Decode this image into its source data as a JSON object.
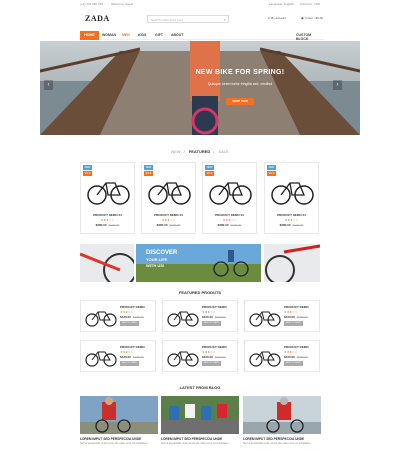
{
  "topbar": {
    "phone": "(+1) 234 566 789",
    "store": "Welcome, Guest",
    "language": "Language: English",
    "currency": "Currency: USD"
  },
  "header": {
    "logo": "ZADA",
    "search_placeholder": "Search entire store here",
    "account": "My account",
    "cart": "0 item - $0.00"
  },
  "nav": {
    "items": [
      "HOME",
      "WOMAN",
      "MEN",
      "KIDS",
      "GIFT",
      "ABOUT"
    ],
    "right": "CUSTOM BLOCK"
  },
  "hero": {
    "title": "NEW BIKE FOR SPRING!",
    "subtitle": "Quisque lorem tortor fringilla sed, vestibul",
    "button": "SHOP NOW",
    "prev": "‹",
    "next": "›"
  },
  "tabs": {
    "new": "NEW",
    "featured": "FEATURED",
    "sale": "SALE"
  },
  "products": [
    {
      "badge1": "NEW",
      "badge2": "SALE",
      "name": "PRODUCT DEMO 01",
      "stars": "★★★☆☆",
      "price": "$380.00",
      "old_price": "$420.00"
    },
    {
      "badge1": "NEW",
      "badge2": "SALE",
      "name": "PRODUCT DEMO 01",
      "stars": "★★★☆☆",
      "price": "$380.00",
      "old_price": "$420.00"
    },
    {
      "badge1": "NEW",
      "badge2": "SALE",
      "name": "PRODUCT DEMO 01",
      "stars": "★★★☆☆",
      "price": "$380.00",
      "old_price": "$420.00"
    },
    {
      "badge1": "NEW",
      "badge2": "SALE",
      "name": "PRODUCT DEMO 01",
      "stars": "★★★☆☆",
      "price": "$380.00",
      "old_price": "$420.00"
    }
  ],
  "banner": {
    "line1": "DISCOVER",
    "line2": "YOUR LIFE",
    "line3": "WITH US!"
  },
  "featured": {
    "title": "FEATURED PRODUTS",
    "items": [
      {
        "name": "PRODUCT DEMO",
        "stars": "★★★☆☆",
        "price": "$420.00",
        "old_price": "$480.00",
        "button": "ADD TO CART"
      },
      {
        "name": "PRODUCT DEMO",
        "stars": "★★★☆☆",
        "price": "$420.00",
        "old_price": "$480.00",
        "button": "ADD TO CART"
      },
      {
        "name": "PRODUCT DEMO",
        "stars": "★★★☆☆",
        "price": "$420.00",
        "old_price": "$480.00",
        "button": "ADD TO CART"
      },
      {
        "name": "PRODUCT DEMO",
        "stars": "★★★☆☆",
        "price": "$420.00",
        "old_price": "$480.00",
        "button": "ADD TO CART"
      },
      {
        "name": "PRODUCT DEMO",
        "stars": "★★★☆☆",
        "price": "$420.00",
        "old_price": "$480.00",
        "button": "ADD TO CART"
      },
      {
        "name": "PRODUCT DEMO",
        "stars": "★★★☆☆",
        "price": "$420.00",
        "old_price": "$480.00",
        "button": "ADD TO CART"
      }
    ]
  },
  "blog": {
    "title": "LATEST FROM BLOG",
    "posts": [
      {
        "title": "LOREM IMPUT SED PERSPECCIA UNDE",
        "desc": "Sed ut perspiciatis unde omnis iste natus error sit voluptatem."
      },
      {
        "title": "LOREM IMPUT SED PERSPECCIA UNDE",
        "desc": "Sed ut perspiciatis unde omnis iste natus error sit voluptatem."
      },
      {
        "title": "LOREM IMPUT SED PERSPECCIA UNDE",
        "desc": "Sed ut perspiciatis unde omnis iste natus error sit voluptatem."
      }
    ]
  },
  "colors": {
    "accent": "#f37021",
    "new_badge": "#4aa3df",
    "sale_badge": "#f37021"
  }
}
